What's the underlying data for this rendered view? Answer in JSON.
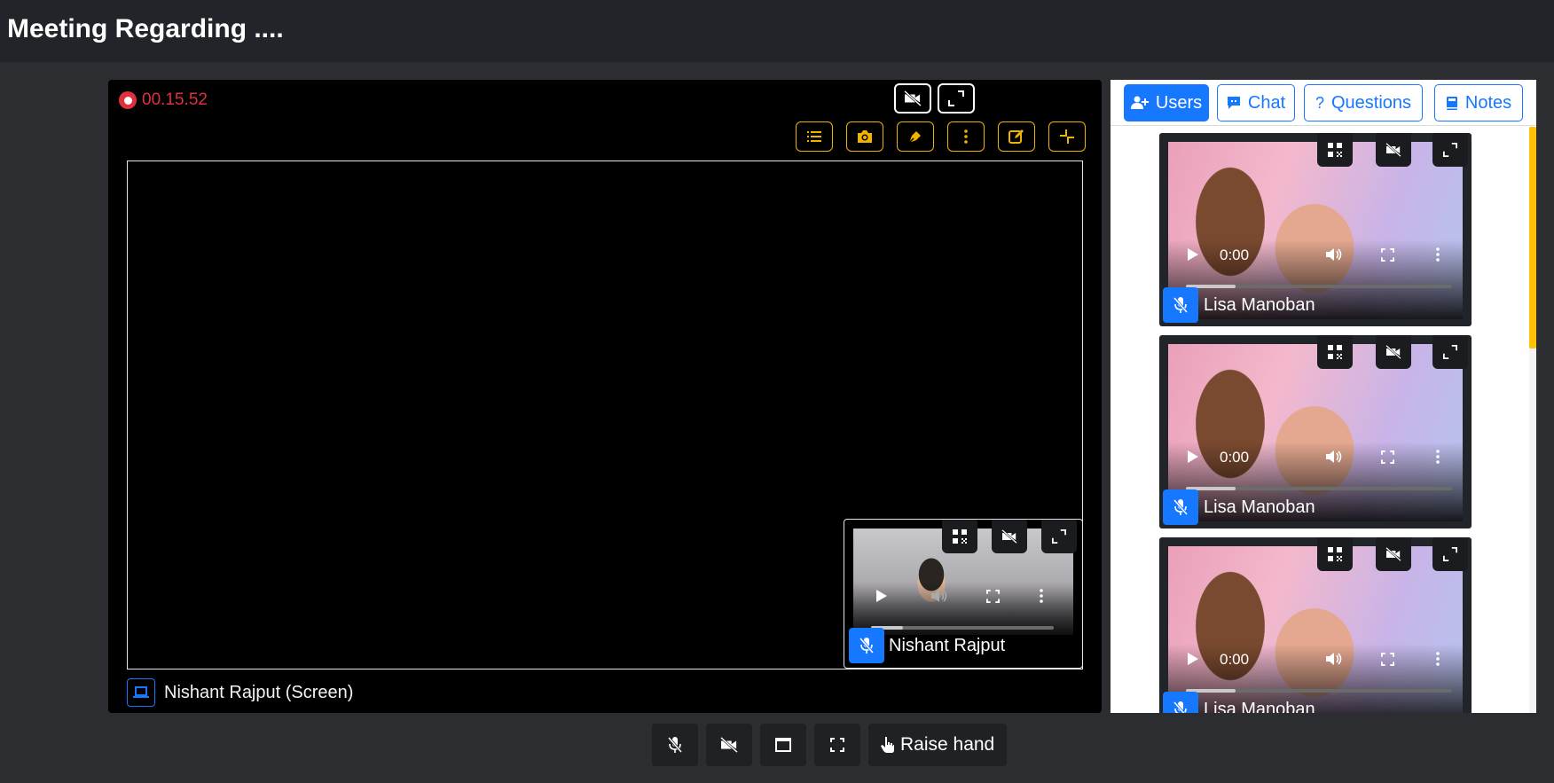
{
  "header": {
    "title": "Meeting Regarding ...."
  },
  "stage": {
    "recording_time": "00.15.52",
    "screen_label": "Nishant Rajput (Screen)",
    "pip": {
      "name": "Nishant Rajput",
      "time": ""
    },
    "icons": {
      "top": [
        "video-off-icon",
        "expand-icon"
      ],
      "toolbar": [
        "list-icon",
        "camera-icon",
        "pen-icon",
        "more-vertical-icon",
        "edit-icon",
        "collapse-icon"
      ]
    }
  },
  "panel": {
    "tabs": [
      {
        "label": "Users",
        "icon": "user-plus-icon",
        "active": true
      },
      {
        "label": "Chat",
        "icon": "chat-icon",
        "active": false
      },
      {
        "label": "Questions",
        "icon": "question-icon",
        "active": false
      },
      {
        "label": "Notes",
        "icon": "book-icon",
        "active": false
      }
    ],
    "users": [
      {
        "name": "Lisa Manoban",
        "time": "0:00"
      },
      {
        "name": "Lisa Manoban",
        "time": "0:00"
      },
      {
        "name": "Lisa Manoban",
        "time": "0:00"
      }
    ]
  },
  "controls": {
    "raise_hand_label": "Raise hand"
  },
  "colors": {
    "accent": "#1677ff",
    "record": "#e0303e",
    "toolbar": "#f0b400",
    "scroll": "#ffc107"
  }
}
